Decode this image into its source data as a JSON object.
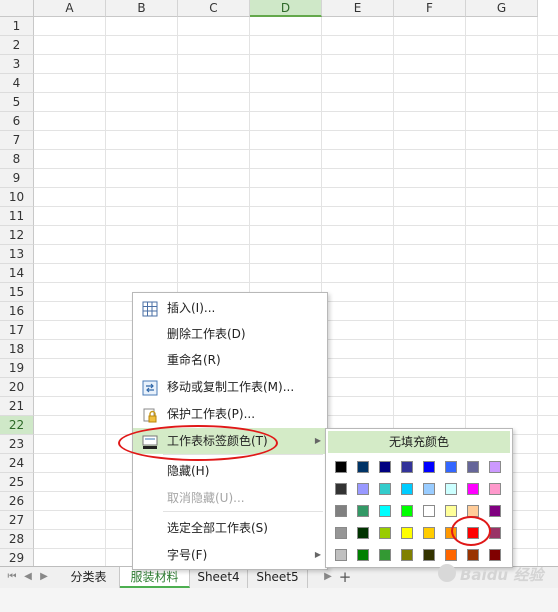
{
  "sheet": {
    "columns": [
      "A",
      "B",
      "C",
      "D",
      "E",
      "F",
      "G"
    ],
    "active_column": "D",
    "rows": [
      "1",
      "2",
      "3",
      "4",
      "5",
      "6",
      "7",
      "8",
      "9",
      "10",
      "11",
      "12",
      "13",
      "14",
      "15",
      "16",
      "17",
      "18",
      "19",
      "20",
      "21",
      "22",
      "23",
      "24",
      "25",
      "26",
      "27",
      "28",
      "29"
    ],
    "active_row": "22"
  },
  "tabs": {
    "items": [
      {
        "label": "分类表",
        "active": false
      },
      {
        "label": "服装材料",
        "active": true
      },
      {
        "label": "Sheet4",
        "active": false
      },
      {
        "label": "Sheet5",
        "active": false
      }
    ],
    "add_label": "+"
  },
  "context_menu": {
    "items": [
      {
        "label": "插入(I)...",
        "icon": "insert-table-icon",
        "enabled": true
      },
      {
        "label": "删除工作表(D)",
        "enabled": true
      },
      {
        "label": "重命名(R)",
        "enabled": true
      },
      {
        "label": "移动或复制工作表(M)...",
        "icon": "move-copy-icon",
        "enabled": true
      },
      {
        "label": "保护工作表(P)...",
        "icon": "lock-icon",
        "enabled": true
      },
      {
        "label": "工作表标签颜色(T)",
        "icon": "tab-color-icon",
        "enabled": true,
        "submenu": true,
        "highlighted": true
      },
      {
        "label": "隐藏(H)",
        "enabled": true
      },
      {
        "label": "取消隐藏(U)...",
        "enabled": false
      },
      {
        "label": "选定全部工作表(S)",
        "enabled": true
      },
      {
        "label": "字号(F)",
        "enabled": true,
        "submenu": true
      }
    ]
  },
  "color_submenu": {
    "no_fill_label": "无填充颜色",
    "swatches": [
      [
        "#000000",
        "#003366",
        "#000080",
        "#333399",
        "#0000ff",
        "#3366ff",
        "#666699",
        "#cc99ff"
      ],
      [
        "#333333",
        "#9999ff",
        "#33cccc",
        "#00ccff",
        "#99ccff",
        "#ccffff",
        "#ff00ff",
        "#ff99cc"
      ],
      [
        "#808080",
        "#339966",
        "#00ffff",
        "#00ff00",
        "#ffffff",
        "#ffff99",
        "#ffcc99",
        "#800080"
      ],
      [
        "#969696",
        "#003300",
        "#99cc00",
        "#ffff00",
        "#ffcc00",
        "#ff9900",
        "#ff0000",
        "#993366"
      ],
      [
        "#c0c0c0",
        "#008000",
        "#339933",
        "#808000",
        "#333300",
        "#ff6600",
        "#993300",
        "#800000"
      ]
    ],
    "highlighted_color": "#ff0000"
  },
  "colors": {
    "accent_green": "#4caf50",
    "menu_hover": "#d4ebc7",
    "annotation_red": "#e01818"
  },
  "watermark": {
    "text": "Baidu 经验"
  }
}
